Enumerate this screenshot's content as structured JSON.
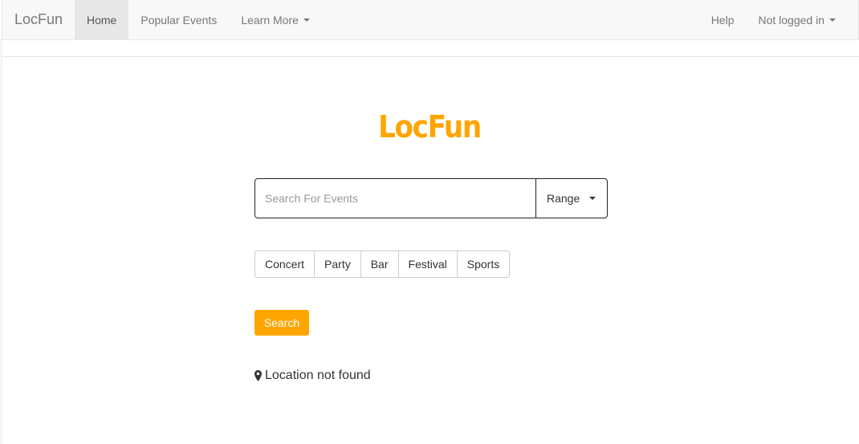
{
  "navbar": {
    "brand": "LocFun",
    "items": [
      {
        "label": "Home",
        "active": true
      },
      {
        "label": "Popular Events"
      },
      {
        "label": "Learn More",
        "dropdown": true
      }
    ],
    "right_items": [
      {
        "label": "Help"
      },
      {
        "label": "Not logged in",
        "dropdown": true
      }
    ]
  },
  "main": {
    "logo_text": "LocFun",
    "search": {
      "placeholder": "Search For Events",
      "value": ""
    },
    "range_label": "Range",
    "categories": [
      "Concert",
      "Party",
      "Bar",
      "Festival",
      "Sports"
    ],
    "search_button": "Search",
    "location_icon": "map-marker-icon",
    "location_text": "Location not found"
  },
  "colors": {
    "accent": "#ffa500",
    "navbar_bg": "#f8f8f8",
    "active_bg": "#e7e7e7"
  }
}
